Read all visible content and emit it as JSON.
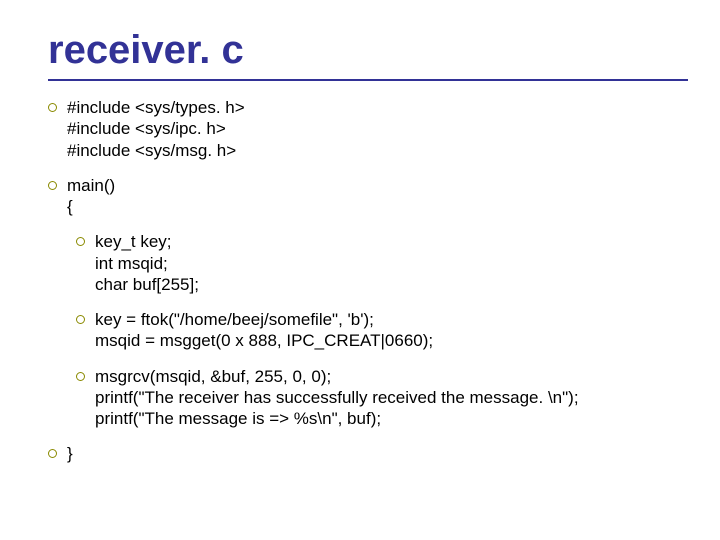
{
  "title": "receiver. c",
  "blocks": [
    "#include <sys/types. h>\n#include <sys/ipc. h>\n#include <sys/msg. h>",
    "main()\n{",
    "key_t key;\nint msqid;\nchar buf[255];",
    "key = ftok(\"/home/beej/somefile\", 'b');\nmsqid = msgget(0 x 888, IPC_CREAT|0660);",
    "msgrcv(msqid, &buf, 255, 0, 0);\nprintf(\"The receiver has successfully received the message. \\n\");\nprintf(\"The message is => %s\\n\", buf);"
  ],
  "closing": "}"
}
